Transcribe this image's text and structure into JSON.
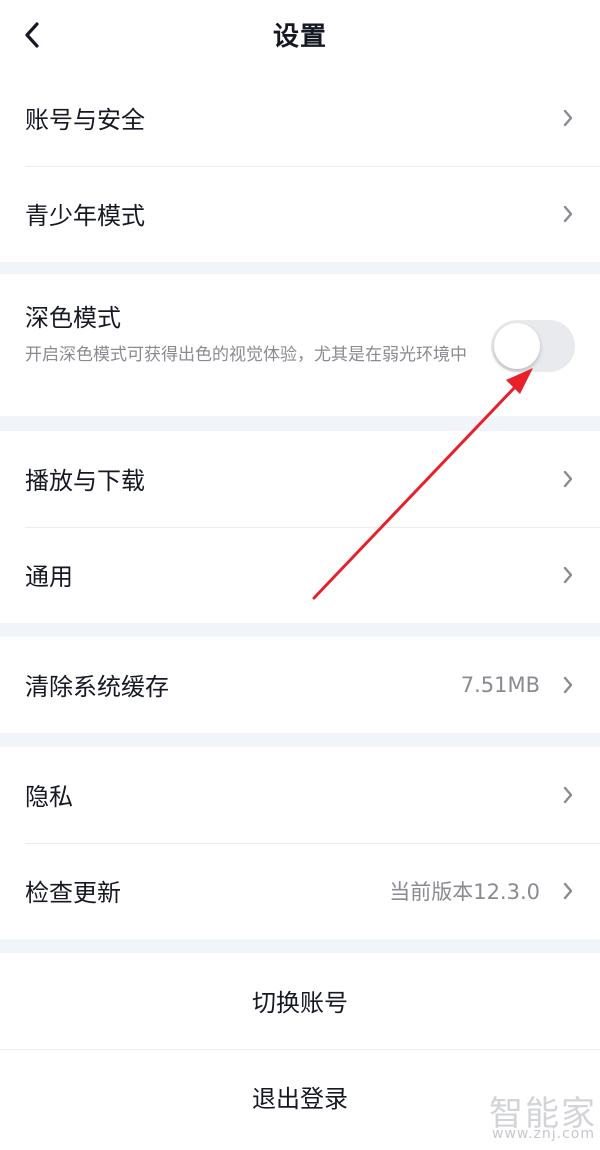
{
  "header": {
    "title": "设置",
    "back_icon": "chevron-left-icon"
  },
  "groups": {
    "account": [
      {
        "label": "账号与安全"
      },
      {
        "label": "青少年模式"
      }
    ],
    "dark_mode": {
      "title": "深色模式",
      "description": "开启深色模式可获得出色的视觉体验，尤其是在弱光环境中",
      "enabled": false
    },
    "media": [
      {
        "label": "播放与下载"
      },
      {
        "label": "通用"
      }
    ],
    "cache": {
      "label": "清除系统缓存",
      "value": "7.51MB"
    },
    "about": [
      {
        "label": "隐私"
      },
      {
        "label": "检查更新",
        "value": "当前版本12.3.0"
      }
    ]
  },
  "actions": {
    "switch_account": "切换账号",
    "logout": "退出登录"
  },
  "annotation": {
    "color": "#e8202a",
    "icon": "red-arrow-annotation"
  },
  "watermark": {
    "logo": "智能家",
    "url": "www.znj.com"
  },
  "colors": {
    "background": "#f1f4f8",
    "card": "#ffffff",
    "text": "#161823",
    "secondary": "#8a8b91"
  }
}
